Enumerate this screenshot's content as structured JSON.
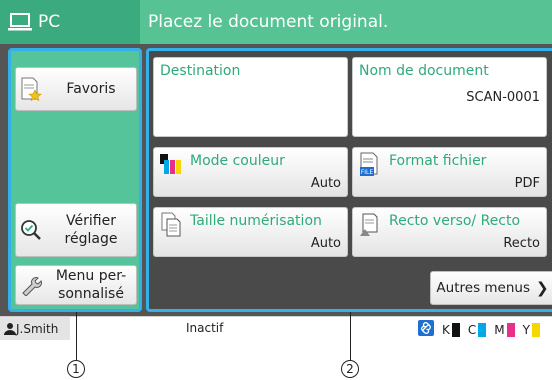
{
  "header": {
    "mode_label": "PC",
    "message": "Placez le document original."
  },
  "left_panel": {
    "favorites_label": "Favoris",
    "verify_label": "Vérifier\nréglage",
    "custom_menu_label": "Menu per-\nsonnalisé"
  },
  "tiles": {
    "destination": {
      "label": "Destination",
      "value": ""
    },
    "document_name": {
      "label": "Nom de document",
      "value": "SCAN-0001"
    },
    "color_mode": {
      "label": "Mode couleur",
      "value": "Auto"
    },
    "file_format": {
      "label": "Format fichier",
      "value": "PDF",
      "icon_tag": "FILE"
    },
    "scan_size": {
      "label": "Taille numérisation",
      "value": "Auto"
    },
    "duplex": {
      "label": "Recto verso/ Recto",
      "value": "Recto"
    }
  },
  "more_menus_label": "Autres menus",
  "status": {
    "user": "J.Smith",
    "state": "Inactif",
    "inks": [
      {
        "letter": "K",
        "color": "#111111"
      },
      {
        "letter": "C",
        "color": "#00a8e8"
      },
      {
        "letter": "M",
        "color": "#e8308a"
      },
      {
        "letter": "Y",
        "color": "#f5d800"
      }
    ]
  },
  "callouts": [
    "1",
    "2"
  ],
  "colors": {
    "accent_green": "#3bab7f",
    "header_green": "#57c294",
    "highlight_blue": "#33b0e8"
  }
}
